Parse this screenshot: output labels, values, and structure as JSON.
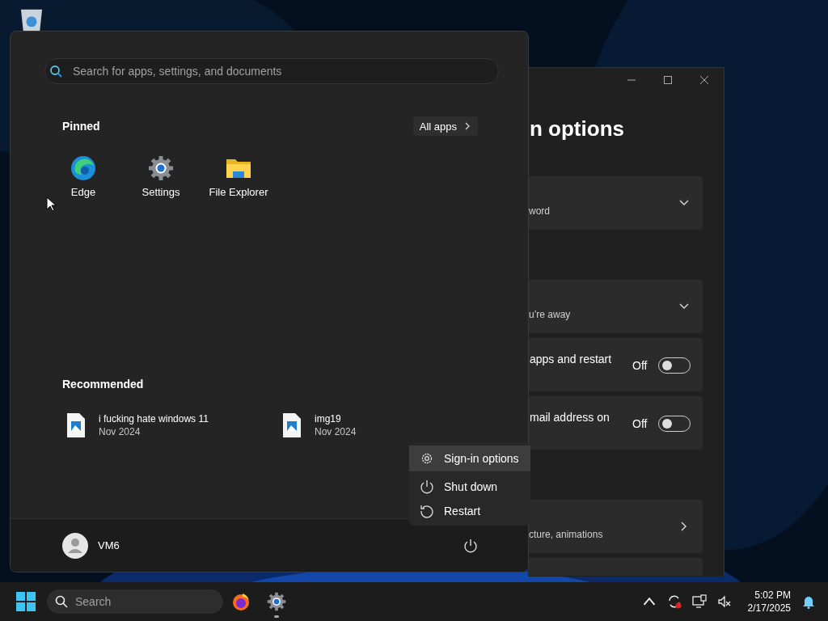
{
  "settings_window": {
    "title": "n options",
    "groups": [
      [
        {
          "kind": "expander",
          "subtitle": "word"
        }
      ],
      [
        {
          "kind": "expander",
          "subtitle": "u’re away"
        },
        {
          "kind": "toggle",
          "label": "apps and restart",
          "state_text": "Off",
          "on": false
        },
        {
          "kind": "toggle",
          "label": "mail address on",
          "state_text": "Off",
          "on": false
        }
      ],
      [
        {
          "kind": "link",
          "subtitle": "cture, animations"
        },
        {
          "kind": "blank"
        }
      ]
    ]
  },
  "start_menu": {
    "search": {
      "placeholder": "Search for apps, settings, and documents"
    },
    "pinned": {
      "title": "Pinned",
      "all_apps": "All apps",
      "apps": [
        {
          "kind": "edge",
          "label": "Edge"
        },
        {
          "kind": "settings",
          "label": "Settings"
        },
        {
          "kind": "folder",
          "label": "File Explorer"
        }
      ]
    },
    "recommended": {
      "title": "Recommended",
      "items": [
        {
          "name": "i fucking hate windows 11",
          "date": "Nov 2024"
        },
        {
          "name": "img19",
          "date": "Nov 2024"
        }
      ]
    },
    "user": {
      "name": "VM6"
    }
  },
  "power_menu": {
    "items": [
      {
        "kind": "gear",
        "label": "Sign-in options",
        "selected": true
      },
      {
        "kind": "power",
        "label": "Shut down",
        "selected": false
      },
      {
        "kind": "restart",
        "label": "Restart",
        "selected": false
      }
    ]
  },
  "taskbar": {
    "search": {
      "placeholder": "Search"
    },
    "apps": [
      {
        "kind": "firefox",
        "running": false
      },
      {
        "kind": "settings",
        "running": true
      }
    ],
    "tray": {
      "time": "5:02 PM",
      "date": "2/17/2025"
    }
  }
}
